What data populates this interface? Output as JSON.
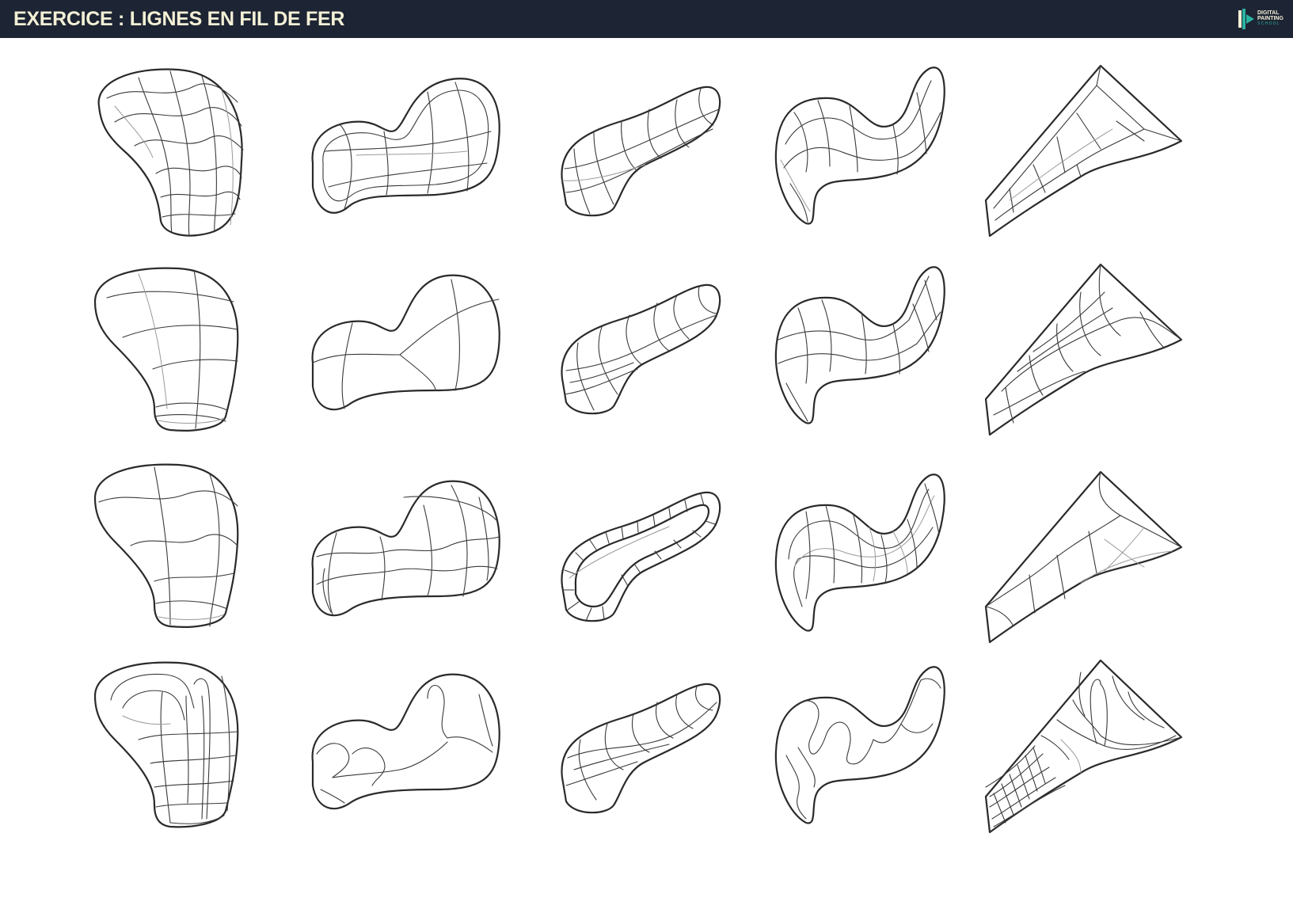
{
  "header": {
    "title": "EXERCICE : LIGNES EN FIL DE FER",
    "background": "#1d2433",
    "title_color": "#f3f0d6"
  },
  "logo": {
    "line1": "DIGITAL",
    "line2": "PAINTING",
    "line3": "SCHOOL",
    "accent": "#2bb3a1"
  },
  "grid": {
    "rows": 4,
    "columns": 5,
    "stroke_color": "#2a2a2a"
  }
}
